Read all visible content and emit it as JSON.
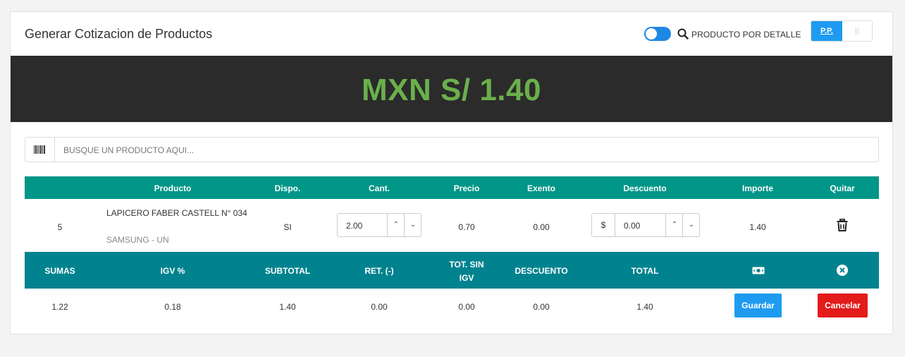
{
  "header": {
    "title": "Generar Cotizacion de Productos",
    "mode_label": "PRODUCTO POR DETALLE",
    "mode_toggle_on": true,
    "btn_pp": "P.P.",
    "btn_pd": "||"
  },
  "total": {
    "display": "MXN S/ 1.40",
    "color": "#6ab04c"
  },
  "search": {
    "placeholder": "BUSQUE UN PRODUCTO AQUI...",
    "value": ""
  },
  "table": {
    "columns": [
      "Producto",
      "Dispo.",
      "Cant.",
      "Precio",
      "Exento",
      "Descuento",
      "Importe",
      "Quitar"
    ],
    "rows": [
      {
        "index": "5",
        "product": "LAPICERO FABER CASTELL N° 034",
        "brand": "SAMSUNG - UN",
        "dispo": "SI",
        "cant": "2.00",
        "precio": "0.70",
        "exento": "0.00",
        "desc_prefix": "$",
        "descuento": "0.00",
        "importe": "1.40"
      }
    ]
  },
  "summary": {
    "headers": {
      "sumas": "SUMAS",
      "igv": "IGV %",
      "subtotal": "SUBTOTAL",
      "ret": "RET. (-)",
      "tot_sin_igv_1": "TOT. SIN",
      "tot_sin_igv_2": "IGV",
      "descuento": "DESCUENTO",
      "total": "TOTAL"
    },
    "values": {
      "sumas": "1.22",
      "igv": "0.18",
      "subtotal": "1.40",
      "ret": "0.00",
      "tot_sin_igv": "0.00",
      "descuento": "0.00",
      "total": "1.40"
    },
    "save_label": "Guardar",
    "cancel_label": "Cancelar"
  },
  "colors": {
    "table_header": "#009688",
    "summary_header": "#00838f",
    "primary": "#1e9bf0",
    "danger": "#e31b1b",
    "total_bar": "#2b2b2b"
  }
}
